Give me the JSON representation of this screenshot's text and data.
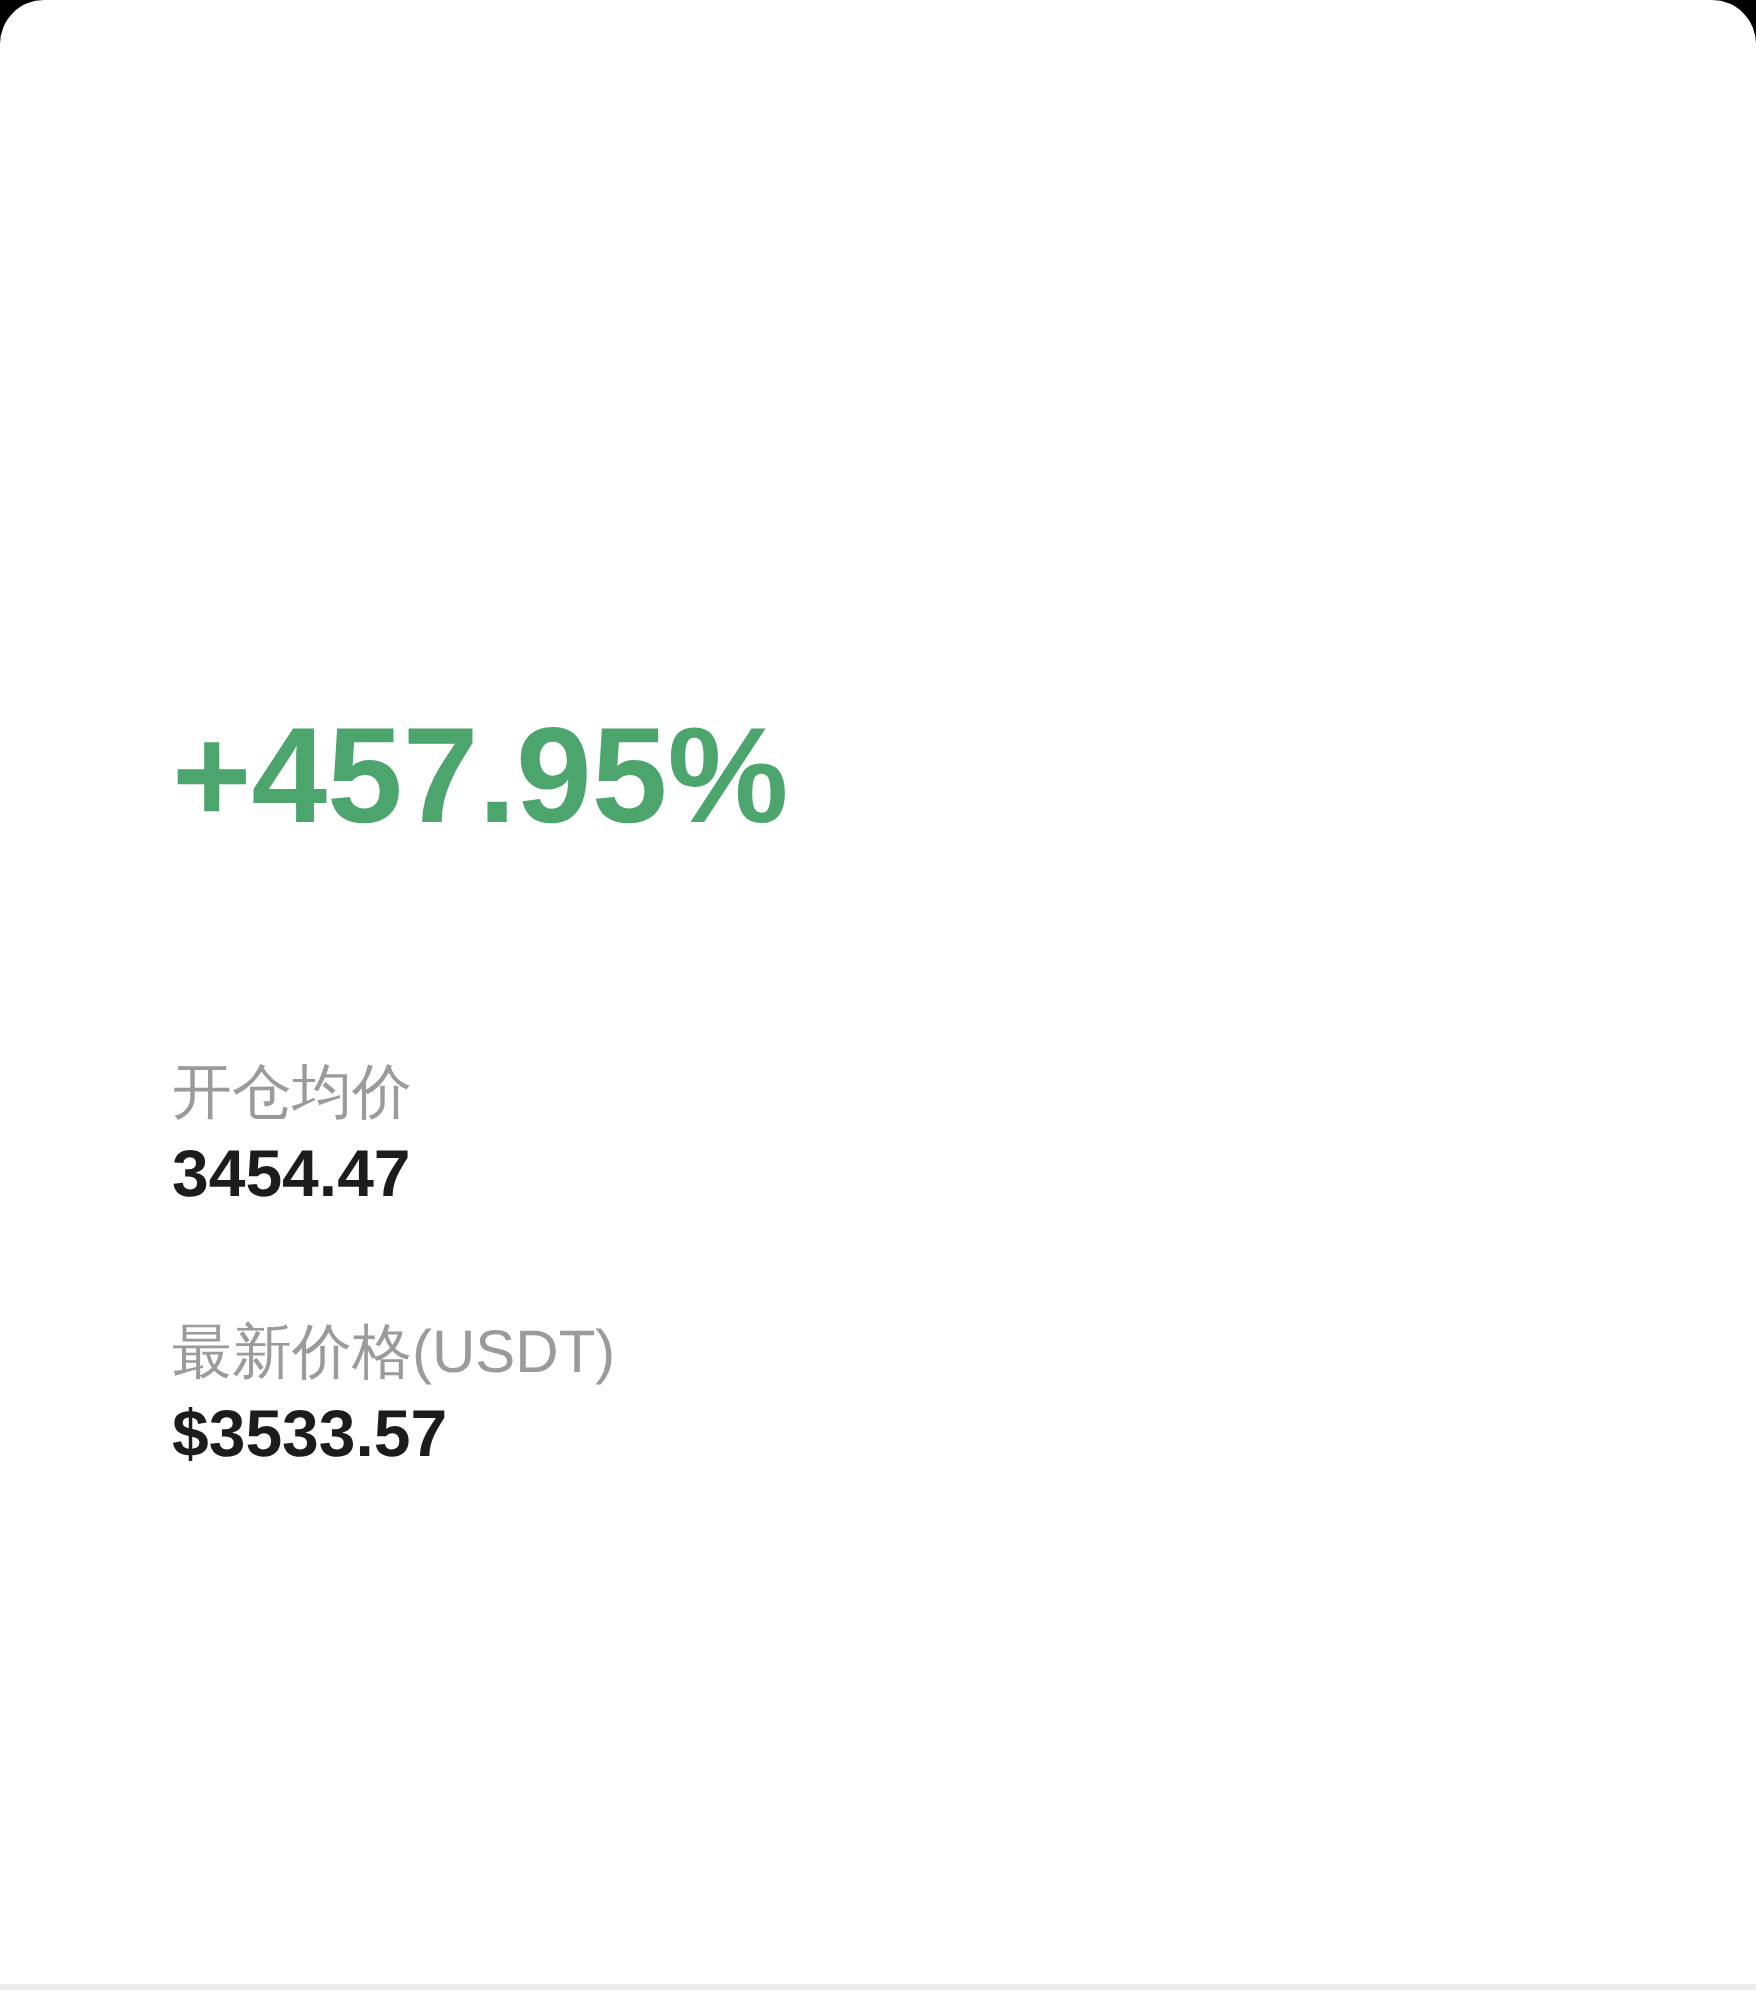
{
  "return_rate": "+457.95%",
  "stats": [
    {
      "label": "开仓均价",
      "value": "3454.47"
    },
    {
      "label": "最新价格(USDT)",
      "value": "$3533.57"
    }
  ]
}
